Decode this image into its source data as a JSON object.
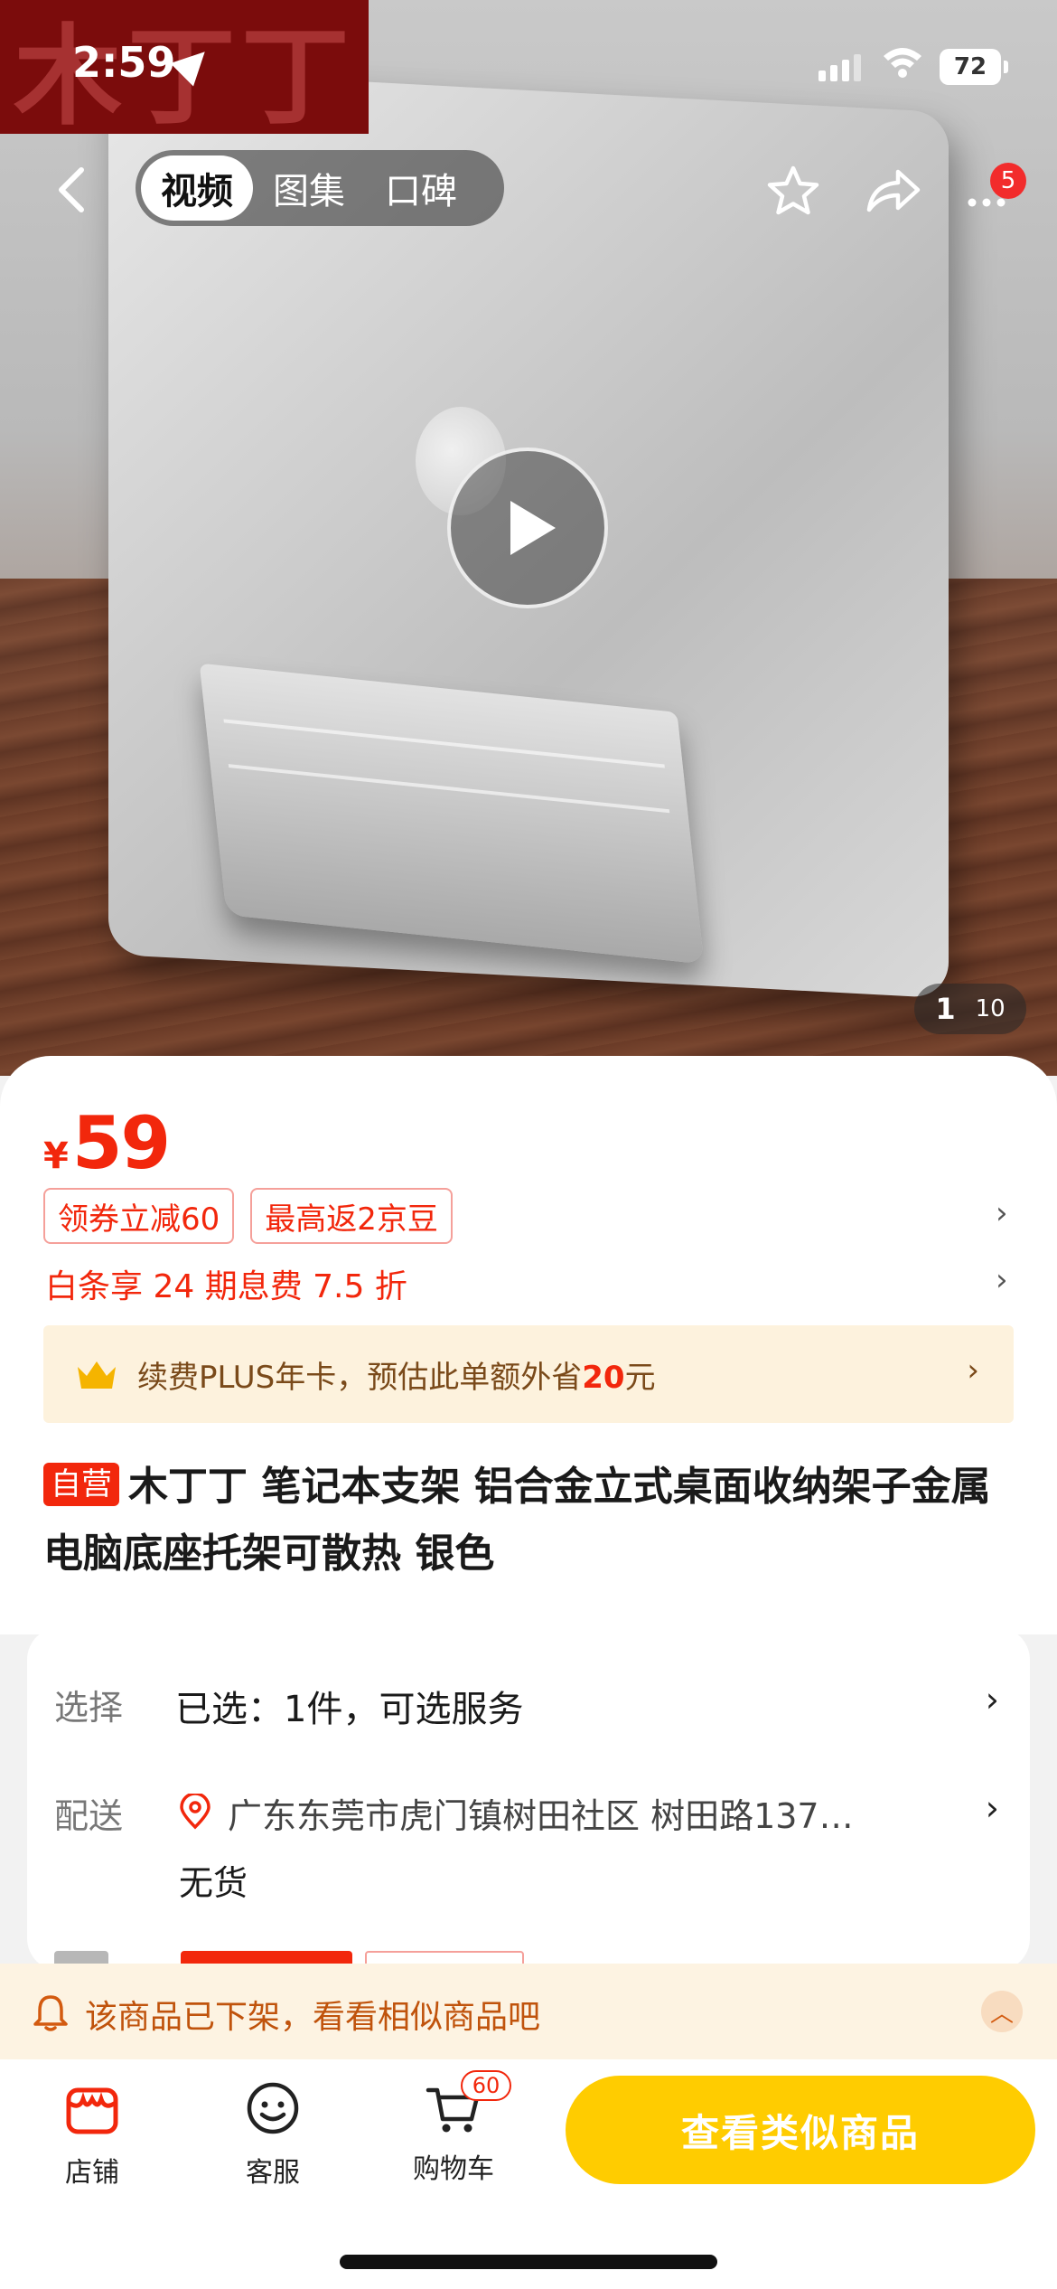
{
  "status_bar": {
    "time": "2:59",
    "battery": "72"
  },
  "brand_logo_text": "木丁丁",
  "media_tabs": [
    {
      "label": "视频",
      "active": true
    },
    {
      "label": "图集",
      "active": false
    },
    {
      "label": "口碑",
      "active": false
    }
  ],
  "top_nav": {
    "more_badge": "5"
  },
  "gallery": {
    "current": "1",
    "total": "10"
  },
  "price": {
    "symbol": "¥",
    "value": "59"
  },
  "promo_tags": [
    "领券立减60",
    "最高返2京豆"
  ],
  "baitiao": "白条享 24 期息费 7.5 折",
  "plus": {
    "text_before": "续费PLUS年卡，预估此单额外省",
    "amount": "20",
    "text_after": "元"
  },
  "product": {
    "self_operated_tag": "自营",
    "title": "木丁丁 笔记本支架 铝合金立式桌面收纳架子金属电脑底座托架可散热 银色"
  },
  "options": {
    "select_label": "选择",
    "select_value": "已选：1件，可选服务",
    "delivery_label": "配送",
    "delivery_address": "广东东莞市虎门镇树田社区 树田路137…",
    "stock_status": "无货"
  },
  "notice": {
    "text": "该商品已下架，看看相似商品吧"
  },
  "bottom_bar": {
    "store_label": "店铺",
    "service_label": "客服",
    "cart_label": "购物车",
    "cart_count": "60",
    "similar_button": "查看类似商品"
  },
  "colors": {
    "accent_red": "#f2270c",
    "cta_yellow": "#ffcc00",
    "notice_bg": "#fdf3e2",
    "plus_bg": "#fdf2dd"
  }
}
